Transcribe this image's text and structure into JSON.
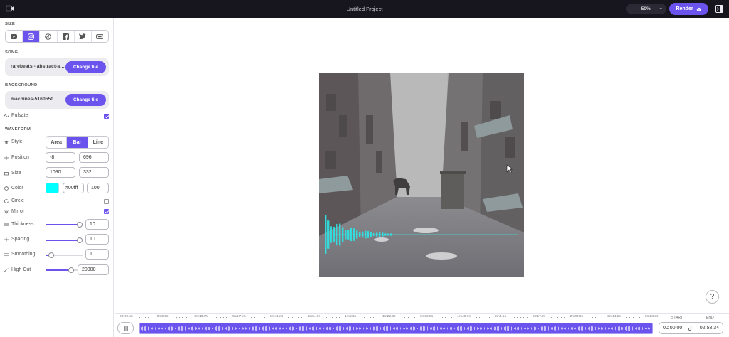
{
  "app": {
    "project_title": "Untitled Project"
  },
  "toolbar": {
    "zoom_minus": "-",
    "zoom_value": "50%",
    "zoom_plus": "+",
    "render_label": "Render"
  },
  "sections": {
    "size": "SIZE",
    "song": "SONG",
    "background": "BACKGROUND",
    "waveform": "WAVEFORM"
  },
  "size_options": [
    "youtube-icon",
    "instagram-icon",
    "tiktok-icon",
    "facebook-icon",
    "twitter-icon",
    "custom-size-icon"
  ],
  "size_selected": 1,
  "song": {
    "file_name": "rarebeats - abstract-ambient",
    "change_label": "Change file"
  },
  "background": {
    "file_name": "machines-5160550",
    "change_label": "Change file",
    "pulsate_label": "Pulsate",
    "pulsate_checked": true
  },
  "waveform": {
    "style_label": "Style",
    "styles": [
      "Area",
      "Bar",
      "Line"
    ],
    "style_selected": 1,
    "position_label": "Position",
    "position_x": "-8",
    "position_y": "696",
    "size_label": "Size",
    "size_w": "1090",
    "size_h": "332",
    "color_label": "Color",
    "color_hex": "#00ffff",
    "color_hex_text": "#00fff",
    "opacity": "100",
    "circle_label": "Circle",
    "circle_checked": false,
    "mirror_label": "Mirror",
    "mirror_checked": true,
    "thickness_label": "Thickness",
    "thickness_value": "10",
    "thickness_fraction": 0.92,
    "spacing_label": "Spacing",
    "spacing_value": "10",
    "spacing_fraction": 0.92,
    "smoothing_label": "Smoothing",
    "smoothing_value": "1",
    "smoothing_fraction": 0.15,
    "highcut_label": "High Cut",
    "highcut_value": "20000",
    "highcut_fraction": 0.7
  },
  "timeline": {
    "ticks": [
      "00:00.66",
      "0m0.0s",
      "0m13.7s",
      "0m27.4s",
      "0m41.2s",
      "0m54.9s",
      "1m8.6s",
      "1m22.3s",
      "1m36.0s",
      "1m49.7s",
      "2m3.5s",
      "2m17.2s",
      "2m30.9s",
      "2m44.6s",
      "2m58.3s"
    ],
    "start_label": "START",
    "end_label": "END",
    "start_value": "00:00.00",
    "end_value": "02:58.34",
    "playhead_fraction": 0.057
  },
  "help_label": "?"
}
